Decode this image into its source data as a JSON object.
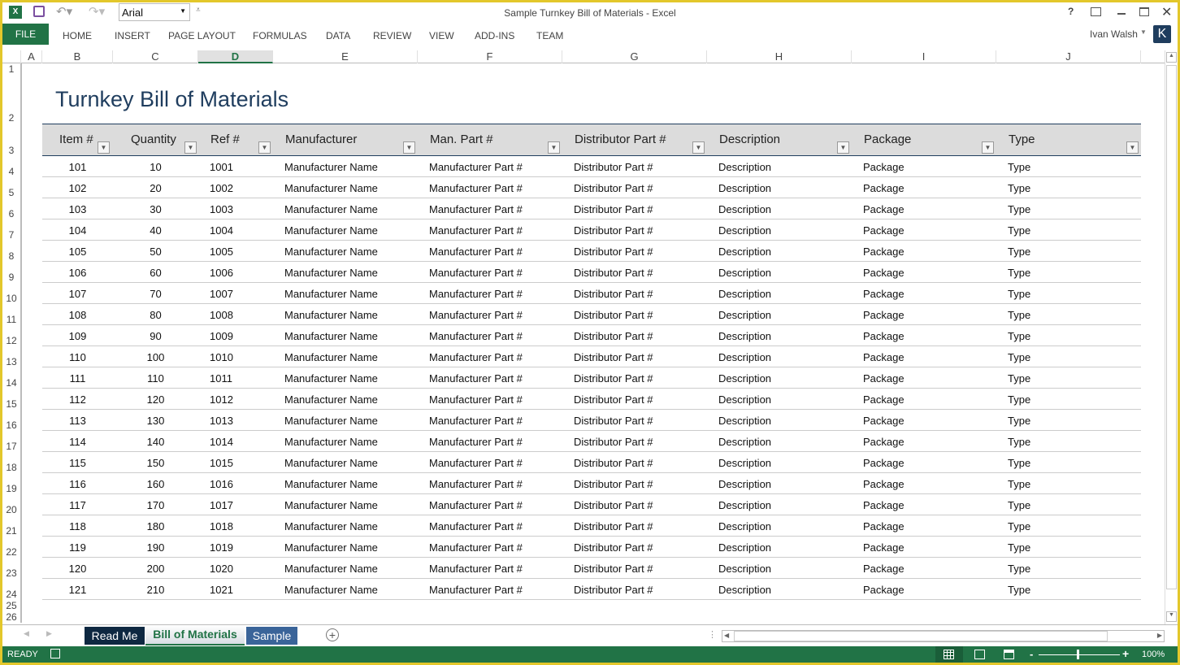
{
  "window": {
    "title": "Sample Turnkey Bill of Materials - Excel",
    "font_box": "Arial",
    "user": "Ivan Walsh",
    "avatar_letter": "K"
  },
  "ribbon": {
    "file": "FILE",
    "tabs": [
      "HOME",
      "INSERT",
      "PAGE LAYOUT",
      "FORMULAS",
      "DATA",
      "REVIEW",
      "VIEW",
      "ADD-INS",
      "TEAM"
    ]
  },
  "columns": [
    "A",
    "B",
    "C",
    "D",
    "E",
    "F",
    "G",
    "H",
    "I",
    "J"
  ],
  "selected_column": "D",
  "rows": [
    "1",
    "2",
    "3",
    "4",
    "5",
    "6",
    "7",
    "8",
    "9",
    "10",
    "11",
    "12",
    "13",
    "14",
    "15",
    "16",
    "17",
    "18",
    "19",
    "20",
    "21",
    "22",
    "23",
    "24",
    "25",
    "26"
  ],
  "sheet": {
    "title": "Turnkey Bill of Materials",
    "headers": [
      "Item #",
      "Quantity",
      "Ref #",
      "Manufacturer",
      "Man. Part #",
      "Distributor Part #",
      "Description",
      "Package",
      "Type"
    ],
    "data": [
      [
        "101",
        "10",
        "1001"
      ],
      [
        "102",
        "20",
        "1002"
      ],
      [
        "103",
        "30",
        "1003"
      ],
      [
        "104",
        "40",
        "1004"
      ],
      [
        "105",
        "50",
        "1005"
      ],
      [
        "106",
        "60",
        "1006"
      ],
      [
        "107",
        "70",
        "1007"
      ],
      [
        "108",
        "80",
        "1008"
      ],
      [
        "109",
        "90",
        "1009"
      ],
      [
        "110",
        "100",
        "1010"
      ],
      [
        "111",
        "110",
        "1011"
      ],
      [
        "112",
        "120",
        "1012"
      ],
      [
        "113",
        "130",
        "1013"
      ],
      [
        "114",
        "140",
        "1014"
      ],
      [
        "115",
        "150",
        "1015"
      ],
      [
        "116",
        "160",
        "1016"
      ],
      [
        "117",
        "170",
        "1017"
      ],
      [
        "118",
        "180",
        "1018"
      ],
      [
        "119",
        "190",
        "1019"
      ],
      [
        "120",
        "200",
        "1020"
      ],
      [
        "121",
        "210",
        "1021"
      ]
    ],
    "placeholders": [
      "Manufacturer Name",
      "Manufacturer Part #",
      "Distributor Part #",
      "Description",
      "Package",
      "Type"
    ]
  },
  "sheet_tabs": [
    {
      "label": "Read Me",
      "active": false
    },
    {
      "label": "Bill of Materials",
      "active": true
    },
    {
      "label": "Sample",
      "active": false
    }
  ],
  "status": {
    "ready": "READY",
    "zoom": "100%"
  },
  "colors": {
    "accent": "#217346",
    "title": "#1f3d5e",
    "border": "#e3c72b"
  }
}
